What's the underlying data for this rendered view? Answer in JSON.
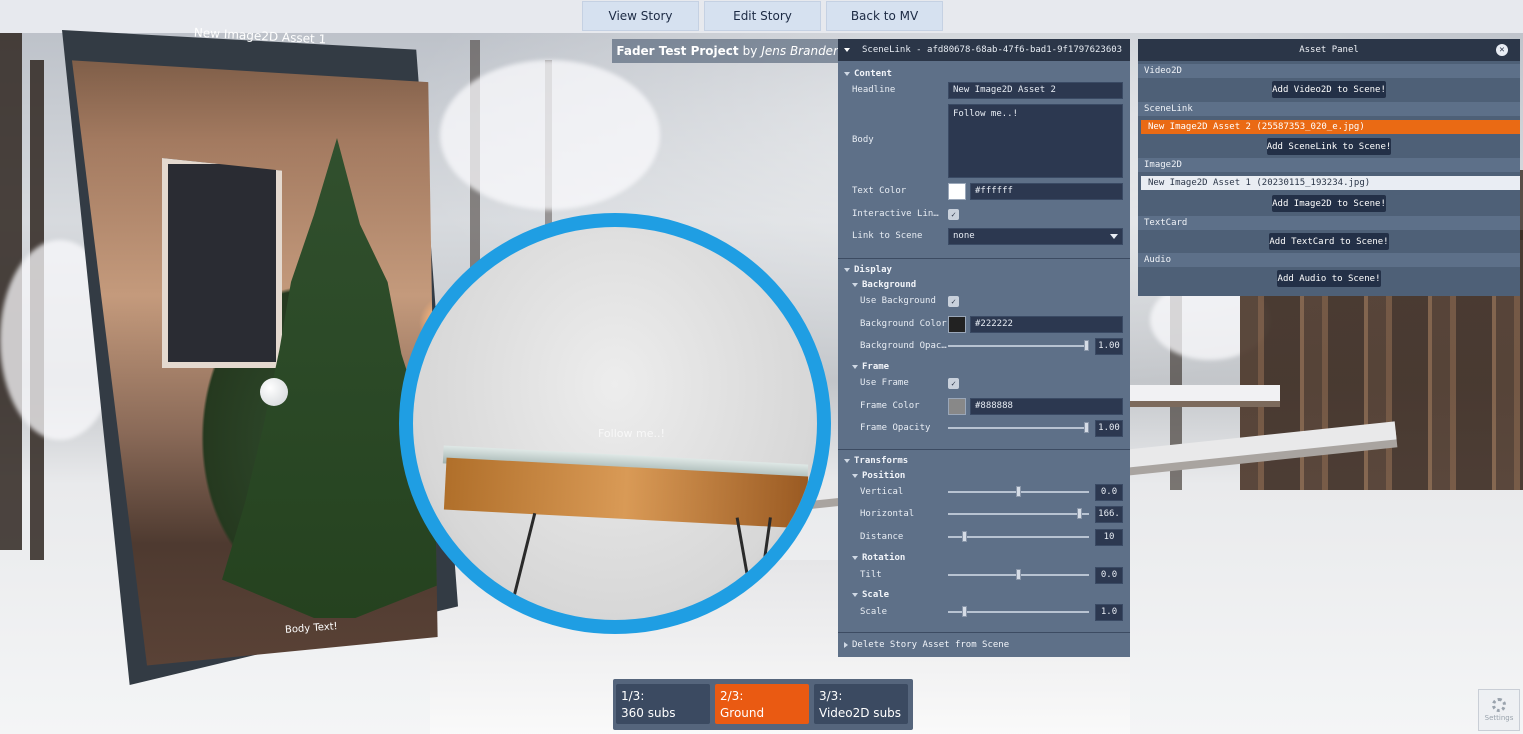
{
  "topbar": {
    "buttons": [
      "View Story",
      "Edit Story",
      "Back to MV"
    ]
  },
  "image2d": {
    "title": "New Image2D Asset 1",
    "body": "Body Text!"
  },
  "scenelink_circle": {
    "text": "Follow me..!"
  },
  "project": {
    "name": "Fader Test Project",
    "by": "by",
    "author": "Jens Brander"
  },
  "inspector": {
    "header": "SceneLink - afd80678-68ab-47f6-bad1-9f1797623603",
    "content": {
      "section": "Content",
      "headline_label": "Headline",
      "headline_value": "New Image2D Asset 2",
      "body_label": "Body",
      "body_value": "Follow me..!",
      "text_color_label": "Text Color",
      "text_color_value": "#ffffff",
      "text_color": "#ffffff",
      "interactive_label": "Interactive Link …",
      "link_label": "Link to Scene",
      "link_value": "none"
    },
    "display": {
      "section": "Display",
      "background": "Background",
      "use_bg_label": "Use Background",
      "bg_color_label": "Background Color",
      "bg_color_value": "#222222",
      "bg_color": "#222222",
      "bg_opacity_label": "Background Opaci…",
      "bg_opacity_value": "1.00",
      "bg_opacity": 1.0,
      "frame": "Frame",
      "use_frame_label": "Use Frame",
      "frame_color_label": "Frame Color",
      "frame_color_value": "#888888",
      "frame_color": "#888888",
      "frame_opacity_label": "Frame Opacity",
      "frame_opacity_value": "1.00",
      "frame_opacity": 1.0
    },
    "transforms": {
      "section": "Transforms",
      "position": "Position",
      "vertical_label": "Vertical",
      "vertical_value": "0.0",
      "vertical_pos": 0.5,
      "horizontal_label": "Horizontal",
      "horizontal_value": "166.",
      "horizontal_pos": 0.95,
      "distance_label": "Distance",
      "distance_value": "10",
      "distance_pos": 0.1,
      "rotation": "Rotation",
      "tilt_label": "Tilt",
      "tilt_value": "0.0",
      "tilt_pos": 0.5,
      "scale": "Scale",
      "scale_label": "Scale",
      "scale_value": "1.0",
      "scale_pos": 0.1
    },
    "delete_label": "Delete Story Asset from Scene"
  },
  "asset_panel": {
    "title": "Asset Panel",
    "video2d": {
      "category": "Video2D",
      "add": "Add Video2D to Scene!"
    },
    "scenelink": {
      "category": "SceneLink",
      "item": "New Image2D Asset 2 (25587353_020_e.jpg)",
      "add": "Add SceneLink to Scene!"
    },
    "image2d": {
      "category": "Image2D",
      "item": "New Image2D Asset 1 (20230115_193234.jpg)",
      "add": "Add Image2D to Scene!"
    },
    "textcard": {
      "category": "TextCard",
      "add": "Add TextCard to Scene!"
    },
    "audio": {
      "category": "Audio",
      "add": "Add Audio to Scene!"
    }
  },
  "tabs": [
    {
      "num": "1/3:",
      "name": "360 subs"
    },
    {
      "num": "2/3:",
      "name": "Ground",
      "active": true
    },
    {
      "num": "3/3:",
      "name": "Video2D subs"
    }
  ],
  "settings_label": "Settings",
  "colors": {
    "accent": "#1f9ee3",
    "active_tab": "#ea5a12",
    "selected_item": "#ea6a14"
  }
}
